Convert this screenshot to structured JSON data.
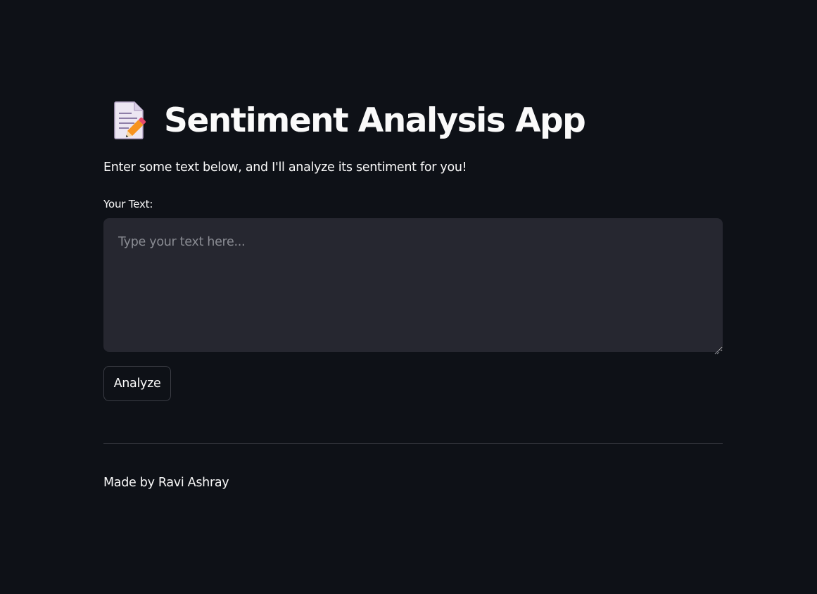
{
  "header": {
    "title": "Sentiment Analysis App",
    "icon": "memo-icon"
  },
  "intro": {
    "text": "Enter some text below, and I'll analyze its sentiment for you!"
  },
  "input": {
    "label": "Your Text:",
    "placeholder": "Type your text here...",
    "value": ""
  },
  "actions": {
    "analyze_label": "Analyze"
  },
  "footer": {
    "text": "Made by Ravi Ashray"
  },
  "colors": {
    "background": "#0e1117",
    "input_background": "#262730",
    "text": "#fafafa",
    "placeholder": "#8a8c93",
    "border": "#3b3d45"
  }
}
